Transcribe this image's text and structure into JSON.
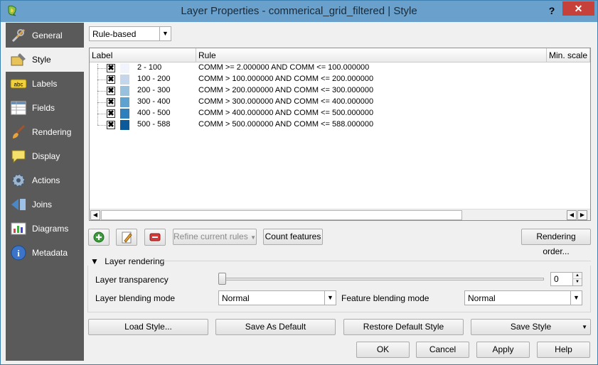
{
  "window": {
    "title": "Layer Properties - commerical_grid_filtered | Style",
    "help": "?",
    "close": "✕"
  },
  "sidebar": {
    "items": [
      {
        "label": "General",
        "icon": "tools-icon"
      },
      {
        "label": "Style",
        "icon": "style-icon"
      },
      {
        "label": "Labels",
        "icon": "labels-icon"
      },
      {
        "label": "Fields",
        "icon": "fields-icon"
      },
      {
        "label": "Rendering",
        "icon": "rendering-brush-icon"
      },
      {
        "label": "Display",
        "icon": "display-speech-icon"
      },
      {
        "label": "Actions",
        "icon": "actions-gear-icon"
      },
      {
        "label": "Joins",
        "icon": "joins-icon"
      },
      {
        "label": "Diagrams",
        "icon": "diagrams-icon"
      },
      {
        "label": "Metadata",
        "icon": "metadata-info-icon"
      }
    ],
    "active": "Style"
  },
  "renderer": {
    "selected": "Rule-based"
  },
  "tree": {
    "headers": [
      "Label",
      "Rule",
      "Min. scale"
    ],
    "rows": [
      {
        "label": "2 - 100",
        "rule": "COMM >= 2.000000 AND COMM <= 100.000000",
        "color": "#f1f4fa",
        "checked": "✖"
      },
      {
        "label": "100 - 200",
        "rule": "COMM > 100.000000 AND COMM <= 200.000000",
        "color": "#c5d6ea",
        "checked": "✖"
      },
      {
        "label": "200 - 300",
        "rule": "COMM > 200.000000 AND COMM <= 300.000000",
        "color": "#99c1de",
        "checked": "✖"
      },
      {
        "label": "300 - 400",
        "rule": "COMM > 300.000000 AND COMM <= 400.000000",
        "color": "#5fa2cf",
        "checked": "✖"
      },
      {
        "label": "400 - 500",
        "rule": "COMM > 400.000000 AND COMM <= 500.000000",
        "color": "#2f7fbc",
        "checked": "✖"
      },
      {
        "label": "500 - 588",
        "rule": "COMM > 500.000000 AND COMM <= 588.000000",
        "color": "#0c5a9a",
        "checked": "✖"
      }
    ]
  },
  "toolbar": {
    "refine": "Refine current rules",
    "count": "Count features",
    "order": "Rendering order..."
  },
  "layer_rendering": {
    "title": "Layer rendering",
    "transparency_label": "Layer transparency",
    "transparency_value": "0",
    "transparency_level": 0,
    "blending_label": "Layer blending mode",
    "blending_value": "Normal",
    "feature_blending_label": "Feature blending mode",
    "feature_blending_value": "Normal"
  },
  "style_buttons": {
    "load": "Load Style...",
    "save_default": "Save As Default",
    "restore": "Restore Default Style",
    "save": "Save Style"
  },
  "dialog_buttons": {
    "ok": "OK",
    "cancel": "Cancel",
    "apply": "Apply",
    "help": "Help"
  }
}
